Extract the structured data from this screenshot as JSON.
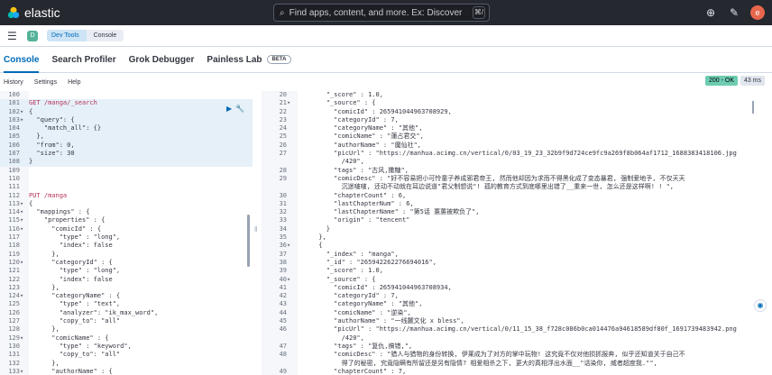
{
  "app": {
    "brand": "elastic"
  },
  "search": {
    "placeholder": "Find apps, content, and more. Ex: Discover",
    "shortcut": "⌘/"
  },
  "breadcrumb": {
    "space": "D",
    "items": [
      "Dev Tools",
      "Console"
    ]
  },
  "tabs": [
    "Console",
    "Search Profiler",
    "Grok Debugger",
    "Painless Lab"
  ],
  "beta_label": "BETA",
  "subnav": [
    "History",
    "Settings",
    "Help"
  ],
  "response": {
    "status": "200 - OK",
    "time": "43 ms"
  },
  "left_lines": [
    {
      "n": "100",
      "f": "",
      "t": ""
    },
    {
      "n": "101",
      "f": "",
      "t": "GET /manga/_search"
    },
    {
      "n": "102",
      "f": "▾",
      "t": "{"
    },
    {
      "n": "103",
      "f": "▾",
      "t": "  \"query\": {"
    },
    {
      "n": "104",
      "f": "",
      "t": "    \"match_all\": {}"
    },
    {
      "n": "105",
      "f": "",
      "t": "  },"
    },
    {
      "n": "106",
      "f": "",
      "t": "  \"from\": 0,"
    },
    {
      "n": "107",
      "f": "",
      "t": "  \"size\": 30"
    },
    {
      "n": "108",
      "f": "",
      "t": "}"
    },
    {
      "n": "109",
      "f": "",
      "t": ""
    },
    {
      "n": "110",
      "f": "",
      "t": ""
    },
    {
      "n": "111",
      "f": "",
      "t": ""
    },
    {
      "n": "112",
      "f": "",
      "t": "PUT /manga"
    },
    {
      "n": "113",
      "f": "▾",
      "t": "{"
    },
    {
      "n": "114",
      "f": "▾",
      "t": "  \"mappings\" : {"
    },
    {
      "n": "115",
      "f": "▾",
      "t": "    \"properties\" : {"
    },
    {
      "n": "116",
      "f": "▾",
      "t": "      \"comicId\" : {"
    },
    {
      "n": "117",
      "f": "",
      "t": "        \"type\" : \"long\","
    },
    {
      "n": "118",
      "f": "",
      "t": "        \"index\": false"
    },
    {
      "n": "119",
      "f": "",
      "t": "      },"
    },
    {
      "n": "120",
      "f": "▾",
      "t": "      \"categoryId\" : {"
    },
    {
      "n": "121",
      "f": "",
      "t": "        \"type\" : \"long\","
    },
    {
      "n": "122",
      "f": "",
      "t": "        \"index\": false"
    },
    {
      "n": "123",
      "f": "",
      "t": "      },"
    },
    {
      "n": "124",
      "f": "▾",
      "t": "      \"categoryName\" : {"
    },
    {
      "n": "125",
      "f": "",
      "t": "        \"type\" : \"text\","
    },
    {
      "n": "126",
      "f": "",
      "t": "        \"analyzer\": \"ik_max_word\","
    },
    {
      "n": "127",
      "f": "",
      "t": "        \"copy_to\": \"all\""
    },
    {
      "n": "128",
      "f": "",
      "t": "      },"
    },
    {
      "n": "129",
      "f": "▾",
      "t": "      \"comicName\" : {"
    },
    {
      "n": "130",
      "f": "",
      "t": "        \"type\" : \"keyword\","
    },
    {
      "n": "131",
      "f": "",
      "t": "        \"copy_to\": \"all\""
    },
    {
      "n": "132",
      "f": "",
      "t": "      },"
    },
    {
      "n": "133",
      "f": "▾",
      "t": "      \"authorName\" : {"
    }
  ],
  "right_lines": [
    {
      "n": "20",
      "f": "",
      "t": "        \"_score\" : 1.0,"
    },
    {
      "n": "21",
      "f": "▾",
      "t": "        \"_source\" : {"
    },
    {
      "n": "22",
      "f": "",
      "t": "          \"comicId\" : 265941044963708929,"
    },
    {
      "n": "23",
      "f": "",
      "t": "          \"categoryId\" : 7,"
    },
    {
      "n": "24",
      "f": "",
      "t": "          \"categoryName\" : \"其他\","
    },
    {
      "n": "25",
      "f": "",
      "t": "          \"comicName\" : \"蓮占君交\","
    },
    {
      "n": "26",
      "f": "",
      "t": "          \"authorName\" : \"魔仙社\","
    },
    {
      "n": "27",
      "f": "",
      "t": "          \"picUrl\" : \"https://manhua.acimg.cn/vertical/0/03_19_23_32b9f9d724ce9fc9a269f8b064af1712_1688383418106.jpg"
    },
    {
      "n": "",
      "f": "",
      "t": "            /420\","
    },
    {
      "n": "28",
      "f": "",
      "t": "          \"tags\" : \"古风,撒糖\","
    },
    {
      "n": "29",
      "f": "",
      "t": "          \"comicDesc\" : \"好不容易把小可怜童子养成邪君帝王, 然而他却因为求而不得黑化成了变态暴君, 强制爱地予, 不仅天天"
    },
    {
      "n": "",
      "f": "",
      "t": "            沉迷啵啵, 还动不动就在耳边说道\"君父制想说\"! 孤的教育方式到底哪里出错了__重来一世, 怎么还是这样啊! ! \","
    },
    {
      "n": "30",
      "f": "",
      "t": "          \"chapterCount\" : 6,"
    },
    {
      "n": "31",
      "f": "",
      "t": "          \"lastChapterNum\" : 6,"
    },
    {
      "n": "32",
      "f": "",
      "t": "          \"lastChapterName\" : \"第5话 蕙蕙被欺负了\","
    },
    {
      "n": "33",
      "f": "",
      "t": "          \"origin\" : \"tencent\""
    },
    {
      "n": "34",
      "f": "",
      "t": "        }"
    },
    {
      "n": "35",
      "f": "",
      "t": "      },"
    },
    {
      "n": "36",
      "f": "▾",
      "t": "      {"
    },
    {
      "n": "37",
      "f": "",
      "t": "        \"_index\" : \"manga\","
    },
    {
      "n": "38",
      "f": "",
      "t": "        \"_id\" : \"265942262276694016\","
    },
    {
      "n": "39",
      "f": "",
      "t": "        \"_score\" : 1.0,"
    },
    {
      "n": "40",
      "f": "▾",
      "t": "        \"_source\" : {"
    },
    {
      "n": "41",
      "f": "",
      "t": "          \"comicId\" : 265941044963708934,"
    },
    {
      "n": "42",
      "f": "",
      "t": "          \"categoryId\" : 7,"
    },
    {
      "n": "43",
      "f": "",
      "t": "          \"categoryName\" : \"其他\","
    },
    {
      "n": "44",
      "f": "",
      "t": "          \"comicName\" : \"逆染\","
    },
    {
      "n": "45",
      "f": "",
      "t": "          \"authorName\" : \"一线麓文化 x bless\","
    },
    {
      "n": "46",
      "f": "",
      "t": "          \"picUrl\" : \"https://manhua.acimg.cn/vertical/0/11_15_38_f728c086b0ca014476a94618589df80f_1691739483942.png"
    },
    {
      "n": "",
      "f": "",
      "t": "            /420\","
    },
    {
      "n": "47",
      "f": "",
      "t": "          \"tags\" : \"复仇,搞错,\","
    },
    {
      "n": "48",
      "f": "",
      "t": "          \"comicDesc\" : \"猎人与猎物的身份转换, 伊莱成为了对方的掌中玩物! 这究竟不仅对他损抓报奔, 似乎还知道关于自己不"
    },
    {
      "n": "",
      "f": "",
      "t": "            得了的秘密, 究竟隐瞒有所留还是另有隐情? 相爱相杀之下, 更大的真相浮出水面__\"话染你, 威者超度我.\"\","
    },
    {
      "n": "49",
      "f": "",
      "t": "          \"chapterCount\" : 7,"
    }
  ]
}
